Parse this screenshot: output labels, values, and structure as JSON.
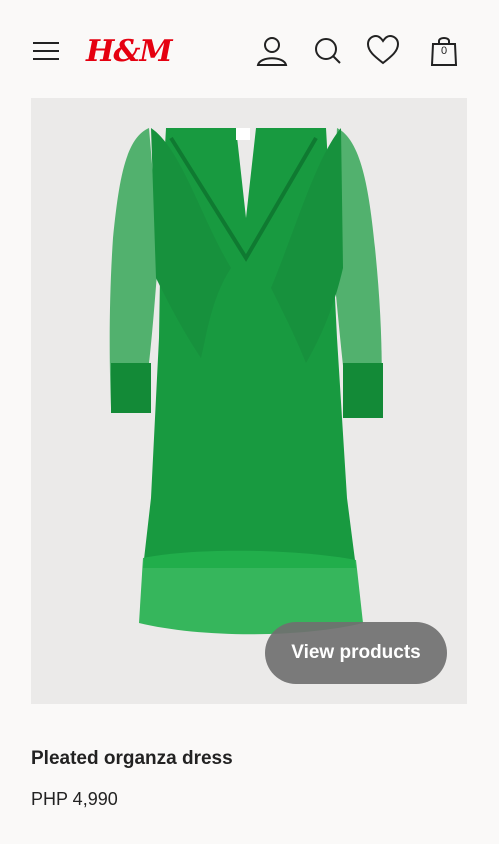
{
  "header": {
    "brand": "H&M",
    "cart_count": "0"
  },
  "product": {
    "name": "Pleated organza dress",
    "price": "PHP 4,990",
    "color": "#1a9a3e"
  },
  "actions": {
    "view_products_label": "View products"
  }
}
